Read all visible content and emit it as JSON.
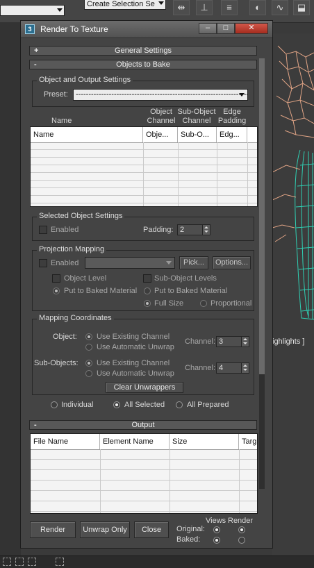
{
  "toolbar": {
    "left_combo_value": "",
    "selection_set_value": "Create Selection Se"
  },
  "viewport": {
    "menu_label": "ighlights ]"
  },
  "dialog": {
    "title": "Render To Texture",
    "icon_letter": "3",
    "window_buttons": {
      "minimize": "–",
      "maximize": "□",
      "close": "✕"
    },
    "rollouts": {
      "general_settings": {
        "toggle": "+",
        "label": "General Settings"
      },
      "objects_to_bake": {
        "toggle": "-",
        "label": "Objects to Bake"
      },
      "output": {
        "toggle": "-",
        "label": "Output"
      }
    },
    "object_output_settings": {
      "title": "Object and Output Settings",
      "preset_label": "Preset:",
      "preset_value": "------------------------------------------------------------------------------"
    },
    "objects_table": {
      "group_headers": {
        "name": "Name",
        "object_channel": [
          "Object",
          "Channel"
        ],
        "sub_object_channel": [
          "Sub-Object",
          "Channel"
        ],
        "edge_padding": [
          "Edge",
          "Padding"
        ]
      },
      "columns": [
        "Name",
        "Obje...",
        "Sub-O...",
        "Edg..."
      ]
    },
    "selected_object_settings": {
      "title": "Selected Object Settings",
      "enabled_label": "Enabled",
      "enabled": false,
      "padding_label": "Padding:",
      "padding_value": "2"
    },
    "projection_mapping": {
      "title": "Projection Mapping",
      "enabled_label": "Enabled",
      "enabled": false,
      "projector_value": "",
      "pick_label": "Pick...",
      "options_label": "Options...",
      "object_level_label": "Object Level",
      "sub_object_levels_label": "Sub-Object Levels",
      "put_to_baked_material_label": "Put to Baked Material",
      "sub_put_to_baked_material_label": "Put to Baked Material",
      "full_size_label": "Full Size",
      "proportional_label": "Proportional"
    },
    "mapping_coordinates": {
      "title": "Mapping Coordinates",
      "object_label": "Object:",
      "sub_objects_label": "Sub-Objects:",
      "use_existing_label": "Use Existing Channel",
      "use_automatic_label": "Use Automatic Unwrap",
      "channel_label": "Channel:",
      "object_channel_value": "3",
      "sub_object_channel_value": "4",
      "clear_unwrappers_label": "Clear Unwrappers"
    },
    "bake_scope": {
      "individual_label": "Individual",
      "all_selected_label": "All Selected",
      "all_prepared_label": "All Prepared",
      "selected": "All Selected"
    },
    "output_table": {
      "columns": [
        "File Name",
        "Element Name",
        "Size",
        "Targ"
      ]
    },
    "footer": {
      "render_label": "Render",
      "unwrap_only_label": "Unwrap Only",
      "close_label": "Close",
      "views_label": "Views",
      "render_col_label": "Render",
      "original_label": "Original:",
      "baked_label": "Baked:"
    }
  }
}
